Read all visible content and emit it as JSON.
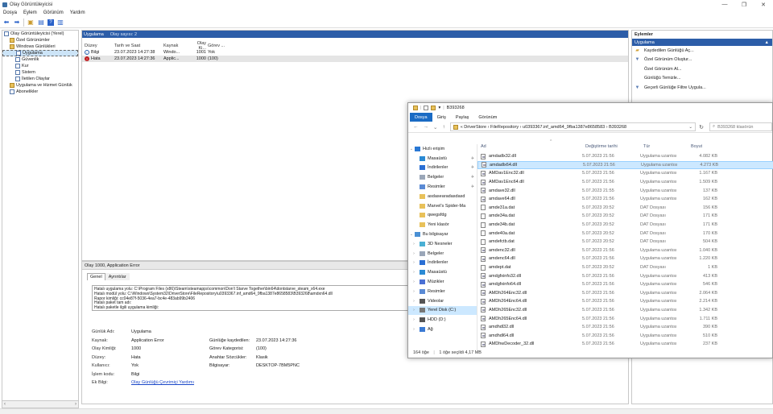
{
  "window": {
    "title": "Olay Görüntüleyicisi"
  },
  "menu": [
    "Dosya",
    "Eylem",
    "Görünüm",
    "Yardım"
  ],
  "tree": [
    {
      "label": "Olay Görüntüleyicisi (Yerel)",
      "indent": 0,
      "icon": "log"
    },
    {
      "label": "Özel Görünümler",
      "indent": 1,
      "icon": "folder"
    },
    {
      "label": "Windows Günlükleri",
      "indent": 1,
      "icon": "folder"
    },
    {
      "label": "Uygulama",
      "indent": 2,
      "icon": "log",
      "selected": true
    },
    {
      "label": "Güvenlik",
      "indent": 2,
      "icon": "log"
    },
    {
      "label": "Kur",
      "indent": 2,
      "icon": "log"
    },
    {
      "label": "Sistem",
      "indent": 2,
      "icon": "log"
    },
    {
      "label": "İletilen Olaylar",
      "indent": 2,
      "icon": "log"
    },
    {
      "label": "Uygulama ve Hizmet Günlük",
      "indent": 1,
      "icon": "folder"
    },
    {
      "label": "Abonelikler",
      "indent": 1,
      "icon": "log"
    }
  ],
  "events": {
    "header_title": "Uygulama",
    "header_count": "Olay sayısı: 2",
    "columns": [
      "Düzey",
      "Tarih ve Saat",
      "Kaynak",
      "Olay Ki...",
      "Görev ..."
    ],
    "rows": [
      {
        "level": "Bilgi",
        "date": "23.07.2023 14:27:38",
        "source": "Windo...",
        "id": "1001",
        "task": "Yok",
        "type": "info"
      },
      {
        "level": "Hata",
        "date": "23.07.2023 14:27:36",
        "source": "Applic...",
        "id": "1000",
        "task": "(100)",
        "type": "error"
      }
    ]
  },
  "detail": {
    "title": "Olay 1000, Application Error",
    "tabs": [
      "Genel",
      "Ayrıntılar"
    ],
    "description": [
      "Hatalı uygulama yolu: C:\\Program Files (x86)\\Steam\\steamapps\\common\\Don't Starve Together\\bin64\\dontstarve_steam_x64.exe",
      "Hatalı modül yolu: C:\\Windows\\System32\\DriverStore\\FileRepository\\u0393367.inf_amd64_9fba1387e8658583\\B393268\\amdxn64.dll",
      "Rapor kimliği: cc04e87f-5036-4ea7-bc4e-483ab99b2406",
      "Hatalı paket tam adı:",
      "Hatalı paketle ilgili uygulama kimliği:"
    ],
    "fields": {
      "log_name_k": "Günlük Adı:",
      "log_name_v": "Uygulama",
      "source_k": "Kaynak:",
      "source_v": "Application Error",
      "logged_k": "Günlüğe kaydedilen:",
      "logged_v": "23.07.2023 14:27:36",
      "eventid_k": "Olay Kimliği:",
      "eventid_v": "1000",
      "category_k": "Görev Kategorisi:",
      "category_v": "(100)",
      "level_k": "Düzey:",
      "level_v": "Hata",
      "keywords_k": "Anahtar Sözcükler:",
      "keywords_v": "Klasik",
      "user_k": "Kullanıcı:",
      "user_v": "Yok",
      "computer_k": "Bilgisayar:",
      "computer_v": "DESKTOP-7BM5PNC",
      "opcode_k": "İşlem kodu:",
      "opcode_v": "Bilgi",
      "moreinfo_k": "Ek Bilgi:",
      "moreinfo_v": "Olay Günlüğü Çevrimiçi Yardımı"
    }
  },
  "actions": {
    "title": "Eylemler",
    "section": "Uygulama",
    "items": [
      {
        "label": "Kaydedilen Günlüğü Aç...",
        "icon": "folder-open-icon"
      },
      {
        "label": "Özel Görünüm Oluştur...",
        "icon": "filter-icon"
      },
      {
        "label": "Özel Görünüm Al...",
        "icon": ""
      },
      {
        "label": "Günlüğü Temizle...",
        "icon": ""
      },
      {
        "label": "Geçerli Günlüğe Filtre Uygula...",
        "icon": "filter-icon"
      }
    ]
  },
  "explorer": {
    "title": "B393268",
    "ribbon": [
      "Dosya",
      "Giriş",
      "Paylaş",
      "Görünüm"
    ],
    "breadcrumb": "«  DriverStore  ›  FileRepository  ›  u0393367.inf_amd64_9fba1387e8658583  ›  B393268",
    "search_placeholder": "B393268 klasörün",
    "nav": [
      {
        "label": "Hızlı erişim",
        "arrow": "⌄",
        "icon": "star",
        "pin": false
      },
      {
        "label": "Masaüstü",
        "arrow": "",
        "icon": "desk",
        "pin": true
      },
      {
        "label": "İndirilenler",
        "arrow": "",
        "icon": "down",
        "pin": true
      },
      {
        "label": "Belgeler",
        "arrow": "",
        "icon": "doc",
        "pin": true
      },
      {
        "label": "Resimler",
        "arrow": "",
        "icon": "pic",
        "pin": true
      },
      {
        "label": "asdasearadasdasd",
        "arrow": "",
        "icon": "folder",
        "pin": false
      },
      {
        "label": "Marvel's Spider-Ma",
        "arrow": "",
        "icon": "folder",
        "pin": false
      },
      {
        "label": "qwegsfdg",
        "arrow": "",
        "icon": "folder",
        "pin": false
      },
      {
        "label": "Yeni klasör",
        "arrow": "",
        "icon": "folder",
        "pin": false
      },
      {
        "label": "Bu bilgisayar",
        "arrow": "⌄",
        "icon": "pc",
        "pin": false
      },
      {
        "label": "3D Nesneler",
        "arrow": "›",
        "icon": "cube",
        "pin": false
      },
      {
        "label": "Belgeler",
        "arrow": "›",
        "icon": "doc",
        "pin": false
      },
      {
        "label": "İndirilenler",
        "arrow": "›",
        "icon": "down",
        "pin": false
      },
      {
        "label": "Masaüstü",
        "arrow": "›",
        "icon": "desk",
        "pin": false
      },
      {
        "label": "Müzikler",
        "arrow": "›",
        "icon": "music",
        "pin": false
      },
      {
        "label": "Resimler",
        "arrow": "›",
        "icon": "pic",
        "pin": false
      },
      {
        "label": "Videolar",
        "arrow": "›",
        "icon": "video",
        "pin": false
      },
      {
        "label": "Yerel Disk (C:)",
        "arrow": "›",
        "icon": "disk",
        "pin": false,
        "selected": true
      },
      {
        "label": "HDD (D:)",
        "arrow": "›",
        "icon": "disk2",
        "pin": false
      },
      {
        "label": "Ağ",
        "arrow": "›",
        "icon": "net",
        "pin": false
      }
    ],
    "columns": [
      "Ad",
      "Değiştirme tarihi",
      "Tür",
      "Boyut"
    ],
    "files": [
      {
        "name": "amdadlx32.dll",
        "date": "5.07.2023 21:56",
        "type": "Uygulama uzantısı",
        "size": "4.082 KB",
        "kind": "dll"
      },
      {
        "name": "amdadlx64.dll",
        "date": "5.07.2023 21:56",
        "type": "Uygulama uzantısı",
        "size": "4.273 KB",
        "kind": "dll",
        "selected": true
      },
      {
        "name": "AMDav1Enc32.dll",
        "date": "5.07.2023 21:56",
        "type": "Uygulama uzantısı",
        "size": "1.167 KB",
        "kind": "dll"
      },
      {
        "name": "AMDav1Enc64.dll",
        "date": "5.07.2023 21:56",
        "type": "Uygulama uzantısı",
        "size": "1.509 KB",
        "kind": "dll"
      },
      {
        "name": "amdave32.dll",
        "date": "5.07.2023 21:55",
        "type": "Uygulama uzantısı",
        "size": "137 KB",
        "kind": "dll"
      },
      {
        "name": "amdave64.dll",
        "date": "5.07.2023 21:56",
        "type": "Uygulama uzantısı",
        "size": "162 KB",
        "kind": "dll"
      },
      {
        "name": "amde31a.dat",
        "date": "5.07.2023 20:52",
        "type": "DAT Dosyası",
        "size": "156 KB",
        "kind": "dat"
      },
      {
        "name": "amde34a.dat",
        "date": "5.07.2023 20:52",
        "type": "DAT Dosyası",
        "size": "171 KB",
        "kind": "dat"
      },
      {
        "name": "amde34b.dat",
        "date": "5.07.2023 20:52",
        "type": "DAT Dosyası",
        "size": "171 KB",
        "kind": "dat"
      },
      {
        "name": "amde40a.dat",
        "date": "5.07.2023 20:52",
        "type": "DAT Dosyası",
        "size": "170 KB",
        "kind": "dat"
      },
      {
        "name": "amdefctb.dat",
        "date": "5.07.2023 20:52",
        "type": "DAT Dosyası",
        "size": "504 KB",
        "kind": "dat"
      },
      {
        "name": "amdenc32.dll",
        "date": "5.07.2023 21:56",
        "type": "Uygulama uzantısı",
        "size": "1.040 KB",
        "kind": "dll"
      },
      {
        "name": "amdenc64.dll",
        "date": "5.07.2023 21:56",
        "type": "Uygulama uzantısı",
        "size": "1.220 KB",
        "kind": "dll"
      },
      {
        "name": "amdept.dat",
        "date": "5.07.2023 20:52",
        "type": "DAT Dosyası",
        "size": "1 KB",
        "kind": "dat"
      },
      {
        "name": "amdgfxinfo32.dll",
        "date": "5.07.2023 21:56",
        "type": "Uygulama uzantısı",
        "size": "413 KB",
        "kind": "dll"
      },
      {
        "name": "amdgfxinfo64.dll",
        "date": "5.07.2023 21:56",
        "type": "Uygulama uzantısı",
        "size": "546 KB",
        "kind": "dll"
      },
      {
        "name": "AMDh264Enc32.dll",
        "date": "5.07.2023 21:56",
        "type": "Uygulama uzantısı",
        "size": "2.064 KB",
        "kind": "dll"
      },
      {
        "name": "AMDh264Enc64.dll",
        "date": "5.07.2023 21:56",
        "type": "Uygulama uzantısı",
        "size": "2.214 KB",
        "kind": "dll"
      },
      {
        "name": "AMDh265Enc32.dll",
        "date": "5.07.2023 21:56",
        "type": "Uygulama uzantısı",
        "size": "1.342 KB",
        "kind": "dll"
      },
      {
        "name": "AMDh265Enc64.dll",
        "date": "5.07.2023 21:56",
        "type": "Uygulama uzantısı",
        "size": "1.711 KB",
        "kind": "dll"
      },
      {
        "name": "amdhdl32.dll",
        "date": "5.07.2023 21:56",
        "type": "Uygulama uzantısı",
        "size": "390 KB",
        "kind": "dll"
      },
      {
        "name": "amdhdl64.dll",
        "date": "5.07.2023 21:56",
        "type": "Uygulama uzantısı",
        "size": "510 KB",
        "kind": "dll"
      },
      {
        "name": "AMDhwDecoder_32.dll",
        "date": "5.07.2023 21:56",
        "type": "Uygulama uzantısı",
        "size": "237 KB",
        "kind": "dll"
      }
    ],
    "status_count": "164 öğe",
    "status_selected": "1 öğe seçildi  4,17 MB"
  }
}
